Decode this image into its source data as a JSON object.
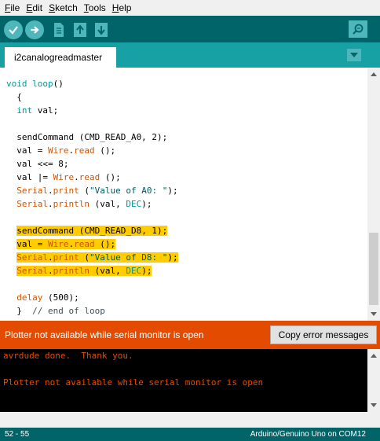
{
  "menu": [
    {
      "prefix": "",
      "underline": "F",
      "suffix": "ile"
    },
    {
      "prefix": "",
      "underline": "E",
      "suffix": "dit"
    },
    {
      "prefix": "",
      "underline": "S",
      "suffix": "ketch"
    },
    {
      "prefix": "",
      "underline": "T",
      "suffix": "ools"
    },
    {
      "prefix": "",
      "underline": "H",
      "suffix": "elp"
    }
  ],
  "toolbar": {
    "buttons": [
      "checkmark-icon",
      "arrow-right-icon",
      "document-icon",
      "arrow-up-icon",
      "arrow-down-icon"
    ],
    "right_button": "serial-monitor-icon"
  },
  "tabs": [
    {
      "label": "i2canalogreadmaster"
    }
  ],
  "editor": {
    "lines": [
      [
        {
          "t": "void",
          "c": "kw"
        },
        {
          "t": " "
        },
        {
          "t": "loop",
          "c": "kw"
        },
        {
          "t": "()"
        }
      ],
      [
        {
          "t": "  {"
        }
      ],
      [
        {
          "t": "  "
        },
        {
          "t": "int",
          "c": "kw"
        },
        {
          "t": " val;"
        }
      ],
      [
        {
          "t": ""
        }
      ],
      [
        {
          "t": "  sendCommand (CMD_READ_A0, 2);"
        }
      ],
      [
        {
          "t": "  val = "
        },
        {
          "t": "Wire",
          "c": "fn"
        },
        {
          "t": "."
        },
        {
          "t": "read",
          "c": "fn"
        },
        {
          "t": " ();"
        }
      ],
      [
        {
          "t": "  val <<= 8;"
        }
      ],
      [
        {
          "t": "  val |= "
        },
        {
          "t": "Wire",
          "c": "fn"
        },
        {
          "t": "."
        },
        {
          "t": "read",
          "c": "fn"
        },
        {
          "t": " ();"
        }
      ],
      [
        {
          "t": "  "
        },
        {
          "t": "Serial",
          "c": "fn"
        },
        {
          "t": "."
        },
        {
          "t": "print",
          "c": "fn"
        },
        {
          "t": " ("
        },
        {
          "t": "\"Value of A0: \"",
          "c": "str"
        },
        {
          "t": ");"
        }
      ],
      [
        {
          "t": "  "
        },
        {
          "t": "Serial",
          "c": "fn"
        },
        {
          "t": "."
        },
        {
          "t": "println",
          "c": "fn"
        },
        {
          "t": " (val, "
        },
        {
          "t": "DEC",
          "c": "kw"
        },
        {
          "t": ");"
        }
      ],
      [
        {
          "t": ""
        }
      ],
      [
        {
          "t": "  "
        },
        {
          "t": "sendCommand (CMD_READ_D8, 1);",
          "h": true
        }
      ],
      [
        {
          "t": "  "
        },
        {
          "t": "val = ",
          "h": true
        },
        {
          "t": "Wire",
          "c": "fn",
          "h": true
        },
        {
          "t": ".",
          "h": true
        },
        {
          "t": "read",
          "c": "fn",
          "h": true
        },
        {
          "t": " ();",
          "h": true
        }
      ],
      [
        {
          "t": "  "
        },
        {
          "t": "Serial",
          "c": "fn",
          "h": true
        },
        {
          "t": ".",
          "h": true
        },
        {
          "t": "print",
          "c": "fn",
          "h": true
        },
        {
          "t": " (",
          "h": true
        },
        {
          "t": "\"Value of D8: \"",
          "c": "str",
          "h": true
        },
        {
          "t": ");",
          "h": true
        }
      ],
      [
        {
          "t": "  "
        },
        {
          "t": "Serial",
          "c": "fn",
          "h": true
        },
        {
          "t": ".",
          "h": true
        },
        {
          "t": "println",
          "c": "fn",
          "h": true
        },
        {
          "t": " (val, ",
          "h": true
        },
        {
          "t": "DEC",
          "c": "kw",
          "h": true
        },
        {
          "t": ");",
          "h": true
        }
      ],
      [
        {
          "t": ""
        }
      ],
      [
        {
          "t": "  "
        },
        {
          "t": "delay",
          "c": "fn"
        },
        {
          "t": " (500);"
        }
      ],
      [
        {
          "t": "  }  "
        },
        {
          "t": "// end of loop",
          "c": "cmt"
        }
      ]
    ]
  },
  "notification": {
    "message": "Plotter not available while serial monitor is open",
    "button_label": "Copy error messages"
  },
  "console": {
    "lines": [
      "avrdude done.  Thank you.",
      "",
      "Plotter not available while serial monitor is open"
    ]
  },
  "status": {
    "line_range": "52 - 55",
    "board": "Arduino/Genuino Uno on COM12"
  }
}
